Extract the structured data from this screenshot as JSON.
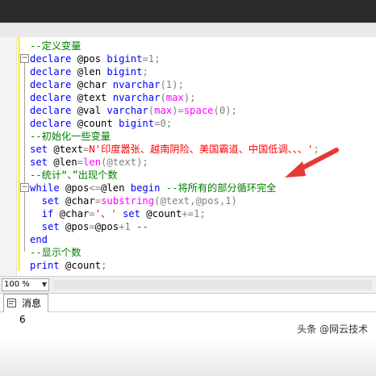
{
  "editor": {
    "lines": [
      {
        "parts": [
          {
            "t": "--定义变量",
            "c": "cm"
          }
        ]
      },
      {
        "parts": [
          {
            "t": "declare",
            "c": "kw"
          },
          {
            "t": " @pos ",
            "c": ""
          },
          {
            "t": "bigint",
            "c": "kw"
          },
          {
            "t": "=1;",
            "c": "op"
          }
        ]
      },
      {
        "parts": [
          {
            "t": "declare",
            "c": "kw"
          },
          {
            "t": " @len ",
            "c": ""
          },
          {
            "t": "bigint",
            "c": "kw"
          },
          {
            "t": ";",
            "c": "op"
          }
        ]
      },
      {
        "parts": [
          {
            "t": "declare",
            "c": "kw"
          },
          {
            "t": " @char ",
            "c": ""
          },
          {
            "t": "nvarchar",
            "c": "kw"
          },
          {
            "t": "(1);",
            "c": "op"
          }
        ]
      },
      {
        "parts": [
          {
            "t": "declare",
            "c": "kw"
          },
          {
            "t": " @text ",
            "c": ""
          },
          {
            "t": "nvarchar",
            "c": "kw"
          },
          {
            "t": "(",
            "c": "op"
          },
          {
            "t": "max",
            "c": "fn"
          },
          {
            "t": ");",
            "c": "op"
          }
        ]
      },
      {
        "parts": [
          {
            "t": "declare",
            "c": "kw"
          },
          {
            "t": " @val ",
            "c": ""
          },
          {
            "t": "varchar",
            "c": "kw"
          },
          {
            "t": "(",
            "c": "op"
          },
          {
            "t": "max",
            "c": "fn"
          },
          {
            "t": ")=",
            "c": "op"
          },
          {
            "t": "space",
            "c": "fn"
          },
          {
            "t": "(0);",
            "c": "op"
          }
        ]
      },
      {
        "parts": [
          {
            "t": "declare",
            "c": "kw"
          },
          {
            "t": " @count ",
            "c": ""
          },
          {
            "t": "bigint",
            "c": "kw"
          },
          {
            "t": "=0;",
            "c": "op"
          }
        ]
      },
      {
        "parts": [
          {
            "t": "--初始化一些变量",
            "c": "cm"
          }
        ]
      },
      {
        "parts": [
          {
            "t": "set",
            "c": "kw"
          },
          {
            "t": " @text",
            "c": ""
          },
          {
            "t": "=",
            "c": "op"
          },
          {
            "t": "N'印度嚣张、越南阴险、美国霸道、中国低调、、、'",
            "c": "str"
          },
          {
            "t": ";",
            "c": "op"
          }
        ]
      },
      {
        "parts": [
          {
            "t": "set",
            "c": "kw"
          },
          {
            "t": " @len",
            "c": ""
          },
          {
            "t": "=",
            "c": "op"
          },
          {
            "t": "len",
            "c": "fn"
          },
          {
            "t": "(@text);",
            "c": "op"
          }
        ]
      },
      {
        "parts": [
          {
            "t": "--统计“、”出现个数",
            "c": "cm"
          }
        ]
      },
      {
        "parts": [
          {
            "t": "while",
            "c": "kw"
          },
          {
            "t": " @pos",
            "c": ""
          },
          {
            "t": "<=",
            "c": "op"
          },
          {
            "t": "@len ",
            "c": ""
          },
          {
            "t": "begin",
            "c": "kw"
          },
          {
            "t": " --将所有的部分循环完全",
            "c": "cm"
          }
        ]
      },
      {
        "parts": [
          {
            "t": "  set",
            "c": "kw"
          },
          {
            "t": " @char",
            "c": ""
          },
          {
            "t": "=",
            "c": "op"
          },
          {
            "t": "substring",
            "c": "fn"
          },
          {
            "t": "(@text,@pos,1)",
            "c": "op"
          }
        ]
      },
      {
        "parts": [
          {
            "t": "  if",
            "c": "kw"
          },
          {
            "t": " @char",
            "c": ""
          },
          {
            "t": "=",
            "c": "op"
          },
          {
            "t": "'、'",
            "c": "str"
          },
          {
            "t": " set",
            "c": "kw"
          },
          {
            "t": " @count",
            "c": ""
          },
          {
            "t": "+=1;",
            "c": "op"
          }
        ]
      },
      {
        "parts": [
          {
            "t": "  set",
            "c": "kw"
          },
          {
            "t": " @pos",
            "c": ""
          },
          {
            "t": "=",
            "c": "op"
          },
          {
            "t": "@pos",
            "c": ""
          },
          {
            "t": "+1 ",
            "c": "op"
          },
          {
            "t": "--",
            "c": "cm"
          }
        ]
      },
      {
        "parts": [
          {
            "t": "end",
            "c": "kw"
          }
        ]
      },
      {
        "parts": [
          {
            "t": "--显示个数",
            "c": "cm"
          }
        ]
      },
      {
        "parts": [
          {
            "t": "print",
            "c": "kw"
          },
          {
            "t": " @count",
            "c": ""
          },
          {
            "t": ";",
            "c": "op"
          }
        ]
      }
    ]
  },
  "status": {
    "zoom": "100 %"
  },
  "results_tab": {
    "label": "消息",
    "icon": "message-icon"
  },
  "results": {
    "value": "6"
  },
  "watermark": "头条 @网云技术",
  "colors": {
    "keyword": "#0000ff",
    "function": "#ff00ff",
    "string": "#ff0000",
    "comment": "#008000",
    "arrow": "#e53935"
  }
}
